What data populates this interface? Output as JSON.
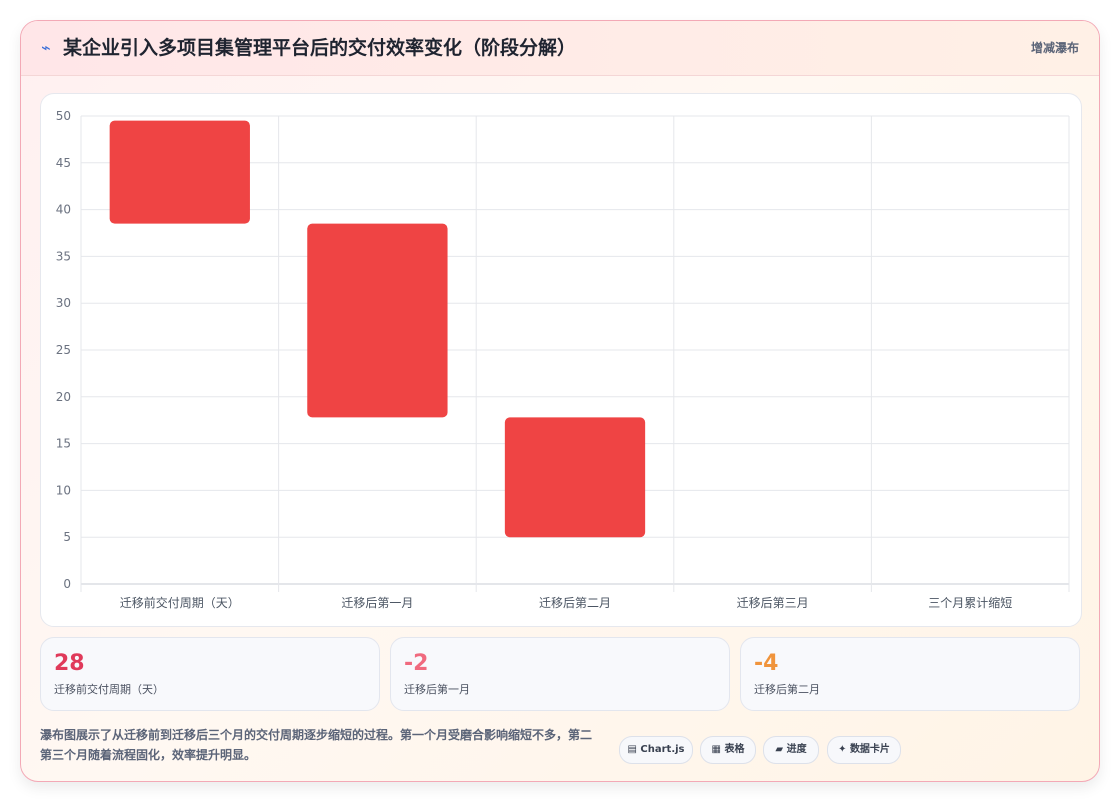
{
  "header": {
    "icon": "chart-trend-icon",
    "title": "某企业引入多项目集管理平台后的交付效率变化（阶段分解）",
    "chart_type_label": "增减瀑布"
  },
  "chart_data": {
    "type": "bar",
    "subtype": "waterfall",
    "categories": [
      "迁移前交付周期（天）",
      "迁移后第一月",
      "迁移后第二月",
      "迁移后第三月",
      "三个月累计缩短"
    ],
    "series": [
      {
        "ranges": [
          [
            38.5,
            49.5
          ],
          [
            17.8,
            38.5
          ],
          [
            5.0,
            17.8
          ],
          null,
          null
        ]
      }
    ],
    "ylim": [
      0,
      50
    ],
    "yticks": [
      0,
      5,
      10,
      15,
      20,
      25,
      30,
      35,
      40,
      45,
      50
    ],
    "grid": true,
    "legend": "none",
    "bar_color": "#ef4444"
  },
  "stats": [
    {
      "value": "28",
      "label": "迁移前交付周期（天）",
      "color": "#e03a5a"
    },
    {
      "value": "-2",
      "label": "迁移后第一月",
      "color": "#f06a7e"
    },
    {
      "value": "-4",
      "label": "迁移后第二月",
      "color": "#f0943c"
    }
  ],
  "description": "瀑布图展示了从迁移前到迁移后三个月的交付周期逐步缩短的过程。第一个月受磨合影响缩短不多，第二第三个月随着流程固化，效率提升明显。",
  "tags": [
    {
      "icon": "monitor-icon",
      "glyph": "▤",
      "label": "Chart.js"
    },
    {
      "icon": "table-icon",
      "glyph": "▦",
      "label": "表格"
    },
    {
      "icon": "progress-icon",
      "glyph": "▰",
      "label": "进度"
    },
    {
      "icon": "card-icon",
      "glyph": "✦",
      "label": "数据卡片"
    }
  ]
}
